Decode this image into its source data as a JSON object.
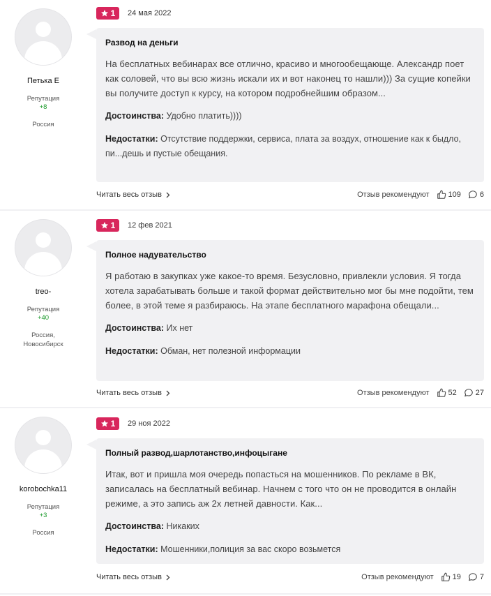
{
  "reviews": [
    {
      "author": "Петька Е",
      "rep_label": "Репутация",
      "rep_value": "+8",
      "location": "Россия",
      "rating": "1",
      "date": "24 мая 2022",
      "title": "Развод на деньги",
      "text": "На бесплатных вебинарах все отлично, красиво и многообещающе. Александр поет как соловей, что вы всю жизнь искали их и вот наконец то нашли))) За сущие копейки вы получите доступ к курсу, на котором подробнейшим образом...",
      "pros_label": "Достоинства:",
      "pros": "Удобно платить))))",
      "cons_label": "Недостатки:",
      "cons": "Отсутствие поддержки, сервиса, плата за воздух, отношение как к быдло, пи...дешь и пустые обещания.",
      "read_more": "Читать весь отзыв",
      "recommend_label": "Отзыв рекомендуют",
      "likes": "109",
      "comments": "6"
    },
    {
      "author": "treo-",
      "rep_label": "Репутация",
      "rep_value": "+40",
      "location": "Россия, Новосибирск",
      "rating": "1",
      "date": "12 фев 2021",
      "title": "Полное надувательство",
      "text": "Я работаю в закупках уже какое-то время. Безусловно, привлекли условия. Я тогда хотела зарабатывать больше и такой формат действительно мог бы мне подойти, тем более, в этой теме я разбираюсь. На этапе бесплатного марафона обещали...",
      "pros_label": "Достоинства:",
      "pros": "Их нет",
      "cons_label": "Недостатки:",
      "cons": "Обман, нет полезной информации",
      "read_more": "Читать весь отзыв",
      "recommend_label": "Отзыв рекомендуют",
      "likes": "52",
      "comments": "27"
    },
    {
      "author": "korobochka11",
      "rep_label": "Репутация",
      "rep_value": "+3",
      "location": "Россия",
      "rating": "1",
      "date": "29 ноя 2022",
      "title": "Полный развод,шарлотанство,инфоцыгане",
      "text": "Итак, вот и пришла моя очередь попасться на мошенников. По рекламе в ВК, записалась на бесплатный вебинар. Начнем с того что он не проводится в онлайн режиме, а это запись аж 2х летней давности. Как...",
      "pros_label": "Достоинства:",
      "pros": "Никаких",
      "cons_label": "Недостатки:",
      "cons": "Мошенники,полиция за вас скоро возьмется",
      "read_more": "Читать весь отзыв",
      "recommend_label": "Отзыв рекомендуют",
      "likes": "19",
      "comments": "7"
    }
  ],
  "colors": {
    "badge": "#d8265c",
    "reputation": "#1a9a2a",
    "bubble": "#f1f1f3"
  },
  "icons": [
    "avatar-placeholder-icon",
    "star-icon",
    "chevron-right-icon",
    "thumbs-up-icon",
    "comment-bubble-icon"
  ]
}
